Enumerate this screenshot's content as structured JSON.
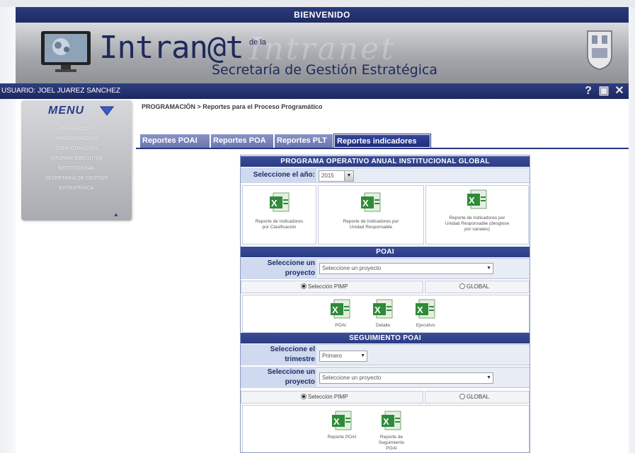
{
  "window": {
    "welcome": "BIENVENIDO"
  },
  "header": {
    "logo_main": "Intran@t",
    "logo_dela": "de la",
    "logo_subtitle": "Secretaría de Gestión Estratégica",
    "watermark": "Intranet"
  },
  "user_bar": {
    "user_label": "USUARIO: JOEL JUAREZ SANCHEZ",
    "icons": [
      "help-icon",
      "print-icon",
      "close-icon"
    ],
    "help_glyph": "?",
    "print_glyph": "▣",
    "close_glyph": "✕"
  },
  "sidebar": {
    "menu_title": "MENU",
    "items": [
      {
        "label": "PLANEACIÓN"
      },
      {
        "label": "PROGRAMACIÓN"
      },
      {
        "label": "CONFIGURACIÓN"
      },
      {
        "label": "INFORME EJECUTIVO"
      },
      {
        "label": "INSTITUCIONAL"
      },
      {
        "label": "SECRETARÍA DE GESTIÓN"
      },
      {
        "label": "ESTRATÉGICA"
      }
    ]
  },
  "breadcrumb": "PROGRAMACIÓN > Reportes para el Proceso Programático",
  "tabs": [
    {
      "label": "Reportes POAI"
    },
    {
      "label": "Reportes POA"
    },
    {
      "label": "Reportes PLT"
    },
    {
      "label": "Reportes indicadores",
      "active": true
    }
  ],
  "section_global": {
    "title": "PROGRAMA OPERATIVO ANUAL INSTITUCIONAL GLOBAL",
    "year_label": "Seleccione el año:",
    "year_value": "2015",
    "reports": [
      {
        "caption": "Reporte de Indicadores por Clasificación"
      },
      {
        "caption": "Reporte de Indicadores por Unidad Responsable"
      },
      {
        "caption": "Reporte de Indicadores por Unidad Responsable (desglose por vanales)"
      }
    ]
  },
  "section_poai": {
    "title": "POAI",
    "project_label": "Seleccione un proyecto",
    "project_value": "Seleccione un proyecto",
    "radio_pimp": "Selección PIMP",
    "radio_global": "GLOBAL",
    "selected_radio": "pimp",
    "reports": [
      {
        "caption": "POAI"
      },
      {
        "caption": "Detalle"
      },
      {
        "caption": "Ejecutivo"
      }
    ]
  },
  "section_seguimiento": {
    "title": "SEGUIMIENTO POAI",
    "quarter_label": "Seleccione el trimestre",
    "quarter_value": "Primero",
    "project_label": "Seleccione un proyecto",
    "project_value": "Seleccione un proyecto",
    "radio_pimp": "Selección PIMP",
    "radio_global": "GLOBAL",
    "selected_radio": "pimp",
    "reports": [
      {
        "caption": "Reporte POAI"
      },
      {
        "caption": "Reporte de Seguimiento POAI"
      }
    ]
  },
  "colors": {
    "header_navy": "#1f2b66",
    "tab_active": "#1f2e7c",
    "excel_green": "#2f8a3a"
  }
}
